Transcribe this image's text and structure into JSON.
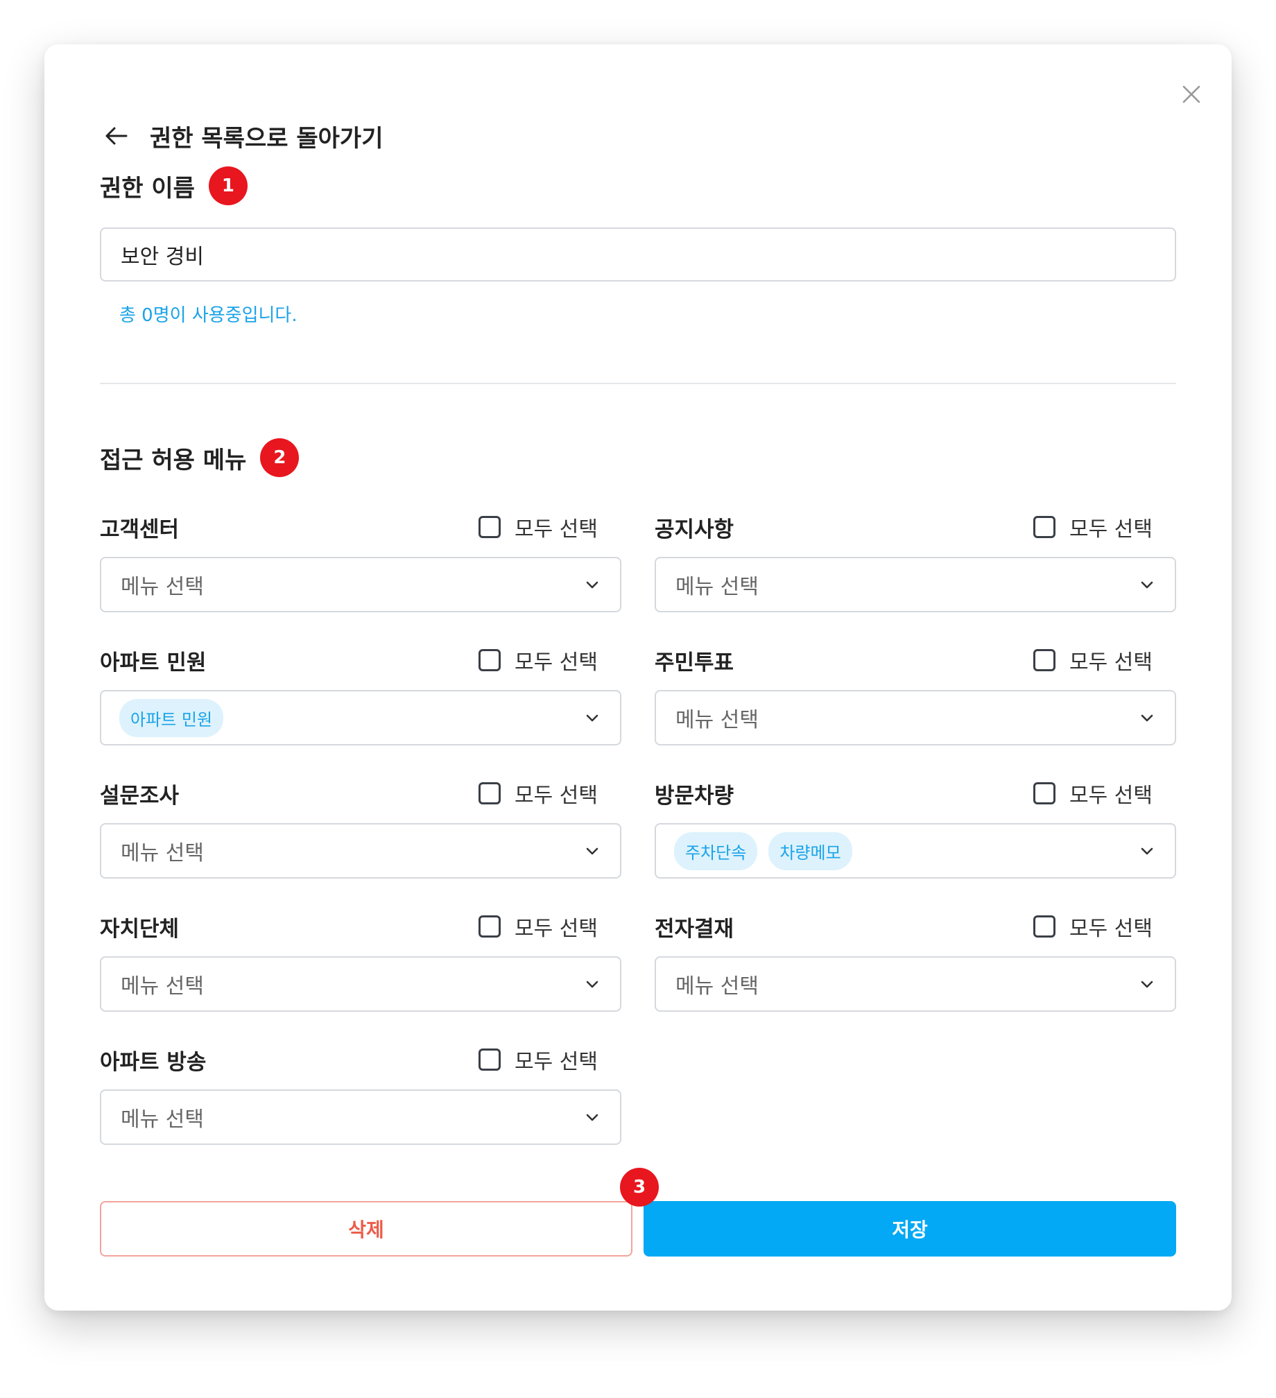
{
  "header": {
    "back_label": "권한 목록으로 돌아가기"
  },
  "name_section": {
    "title": "권한 이름",
    "badge": "1",
    "value": "보안 경비",
    "usage_note": "총 0명이 사용중입니다."
  },
  "menu_section": {
    "title": "접근 허용 메뉴",
    "badge": "2",
    "select_all_label": "모두 선택",
    "placeholder": "메뉴 선택",
    "groups": [
      {
        "label": "고객센터",
        "chips": []
      },
      {
        "label": "공지사항",
        "chips": []
      },
      {
        "label": "아파트 민원",
        "chips": [
          "아파트 민원"
        ]
      },
      {
        "label": "주민투표",
        "chips": []
      },
      {
        "label": "설문조사",
        "chips": []
      },
      {
        "label": "방문차량",
        "chips": [
          "주차단속",
          "차량메모"
        ]
      },
      {
        "label": "자치단체",
        "chips": []
      },
      {
        "label": "전자결재",
        "chips": []
      },
      {
        "label": "아파트 방송",
        "chips": []
      }
    ]
  },
  "actions": {
    "delete_label": "삭제",
    "save_label": "저장",
    "badge": "3"
  },
  "colors": {
    "badge": "#e8161e",
    "primary": "#03a9f4",
    "danger": "#ec5b48",
    "chip_bg": "#ddf2fc",
    "chip_text": "#1aa3e8"
  }
}
